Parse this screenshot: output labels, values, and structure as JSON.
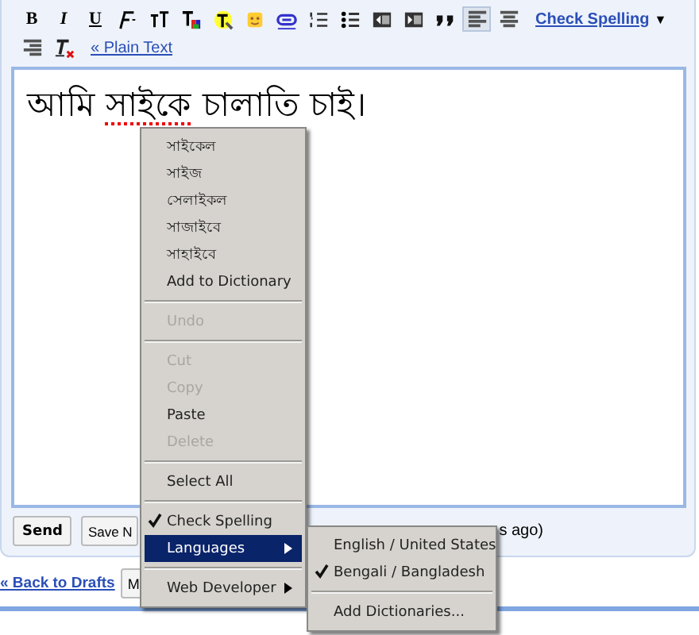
{
  "toolbar": [
    {
      "kind": "bold",
      "label": "B",
      "selected": false
    },
    {
      "kind": "italic",
      "label": "I",
      "selected": false
    },
    {
      "kind": "underline",
      "label": "U",
      "selected": false
    },
    {
      "kind": "font",
      "selected": false
    },
    {
      "kind": "size",
      "selected": false
    },
    {
      "kind": "textcolor",
      "selected": false
    },
    {
      "kind": "highlight",
      "selected": false
    },
    {
      "kind": "smiley",
      "selected": false
    },
    {
      "kind": "link",
      "selected": false
    },
    {
      "kind": "numbered",
      "selected": false
    },
    {
      "kind": "bullets",
      "selected": false
    },
    {
      "kind": "outdent",
      "selected": false
    },
    {
      "kind": "indent",
      "selected": false
    },
    {
      "kind": "quote",
      "selected": false
    },
    {
      "kind": "alignleft",
      "selected": true
    },
    {
      "kind": "aligncenter",
      "selected": false
    },
    {
      "kind": "alignright",
      "selected": false
    },
    {
      "kind": "clearformat",
      "selected": false
    }
  ],
  "check_spelling_link": "Check Spelling",
  "check_spelling_caret": "▼",
  "plain_text_link": "« Plain Text",
  "editor": {
    "before": "আমি ",
    "misspelled": "সাইকে",
    "after": " চালাতি চাই।"
  },
  "bottom_buttons": [
    "Send",
    "Save N"
  ],
  "saved_status": "s ago)",
  "back_link": "« Back to Drafts",
  "lower_button": "M",
  "context_menu": [
    {
      "kind": "item",
      "label": "সাইকেল",
      "disabled": false
    },
    {
      "kind": "item",
      "label": "সাইজ",
      "disabled": false
    },
    {
      "kind": "item",
      "label": "সেলাইকল",
      "disabled": false
    },
    {
      "kind": "item",
      "label": "সাজাইবে",
      "disabled": false
    },
    {
      "kind": "item",
      "label": "সাহাইবে",
      "disabled": false
    },
    {
      "kind": "item",
      "label": "Add to Dictionary",
      "disabled": false
    },
    {
      "kind": "separator"
    },
    {
      "kind": "item",
      "label": "Undo",
      "disabled": true
    },
    {
      "kind": "separator"
    },
    {
      "kind": "item",
      "label": "Cut",
      "disabled": true
    },
    {
      "kind": "item",
      "label": "Copy",
      "disabled": true
    },
    {
      "kind": "item",
      "label": "Paste",
      "disabled": false
    },
    {
      "kind": "item",
      "label": "Delete",
      "disabled": true
    },
    {
      "kind": "separator"
    },
    {
      "kind": "item",
      "label": "Select All",
      "disabled": false
    },
    {
      "kind": "separator"
    },
    {
      "kind": "check",
      "label": "Check Spelling",
      "checked": true
    },
    {
      "kind": "submenu",
      "label": "Languages",
      "selected": true
    },
    {
      "kind": "separator"
    },
    {
      "kind": "submenu",
      "label": "Web Developer",
      "selected": false
    }
  ],
  "languages_menu": [
    {
      "kind": "check",
      "label": "English / United States",
      "checked": false
    },
    {
      "kind": "check",
      "label": "Bengali / Bangladesh",
      "checked": true
    },
    {
      "kind": "separator"
    },
    {
      "kind": "item",
      "label": "Add Dictionaries...",
      "disabled": false
    }
  ]
}
